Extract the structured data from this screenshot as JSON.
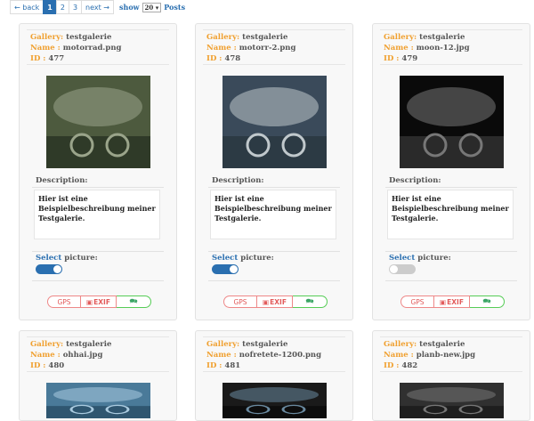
{
  "pagination": {
    "prev": "← back",
    "pages": [
      "1",
      "2",
      "3"
    ],
    "active_page": "1",
    "next": "next →",
    "show_label": "show",
    "per_page": "20 ▾",
    "posts_label": "Posts"
  },
  "labels": {
    "gallery": "Gallery:",
    "name": "Name :",
    "id": "ID :",
    "description": "Description:",
    "select_bold": "Select",
    "select_rest": " picture:",
    "gps": "GPS",
    "exif": "EXIF"
  },
  "cards": [
    {
      "gallery": "testgalerie",
      "name": "motorrad.png",
      "id": "477",
      "description": "Hier ist eine Beispielbeschreibung meiner Testgalerie.",
      "selected": true,
      "palette": [
        "#4d5a3e",
        "#9aa48a",
        "#2f3a28"
      ]
    },
    {
      "gallery": "testgalerie",
      "name": "motorr-2.png",
      "id": "478",
      "description": "Hier ist eine Beispielbeschreibung meiner Testgalerie.",
      "selected": true,
      "palette": [
        "#3a4a5a",
        "#c0c8cc",
        "#2c3a44"
      ]
    },
    {
      "gallery": "testgalerie",
      "name": "moon-12.jpg",
      "id": "479",
      "description": "Hier ist eine Beispielbeschreibung meiner Testgalerie.",
      "selected": false,
      "palette": [
        "#0a0a0a",
        "#777",
        "#2a2a2a"
      ]
    },
    {
      "gallery": "testgalerie",
      "name": "ohhai.jpg",
      "id": "480",
      "palette": [
        "#4a7a99",
        "#aacbe0",
        "#2f5670"
      ]
    },
    {
      "gallery": "testgalerie",
      "name": "nofretete-1200.png",
      "id": "481",
      "palette": [
        "#1a1a1a",
        "#6a8aa0",
        "#0d0d0d"
      ]
    },
    {
      "gallery": "testgalerie",
      "name": "planb-new.jpg",
      "id": "482",
      "palette": [
        "#303030",
        "#777",
        "#1e1e1e"
      ]
    }
  ],
  "colors": {
    "accent": "#2a6fb0",
    "label_orange": "#f0a030",
    "gps_red": "#e25b5b",
    "comment_green": "#3aa565"
  }
}
